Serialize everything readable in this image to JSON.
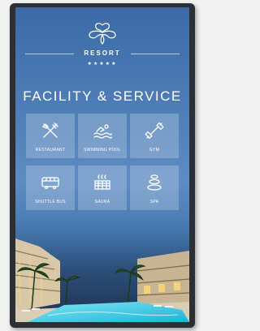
{
  "brand": {
    "name": "RESORT",
    "stars": "★★★★★"
  },
  "heading": "FACILITY & SERVICE",
  "facilities": [
    {
      "label": "RESTAURANT",
      "icon": "fork-knife-icon"
    },
    {
      "label": "SWIMMING POOL",
      "icon": "swimmer-icon"
    },
    {
      "label": "GYM",
      "icon": "dumbbell-icon"
    },
    {
      "label": "SHUTTLE BUS",
      "icon": "bus-icon"
    },
    {
      "label": "SAUNA",
      "icon": "sauna-icon"
    },
    {
      "label": "SPA",
      "icon": "spa-stones-icon"
    }
  ],
  "colors": {
    "screen_top": "#3d6aa6",
    "tile": "rgba(255,255,255,0.22)",
    "text": "#ffffff",
    "bezel": "#2c2f33"
  }
}
